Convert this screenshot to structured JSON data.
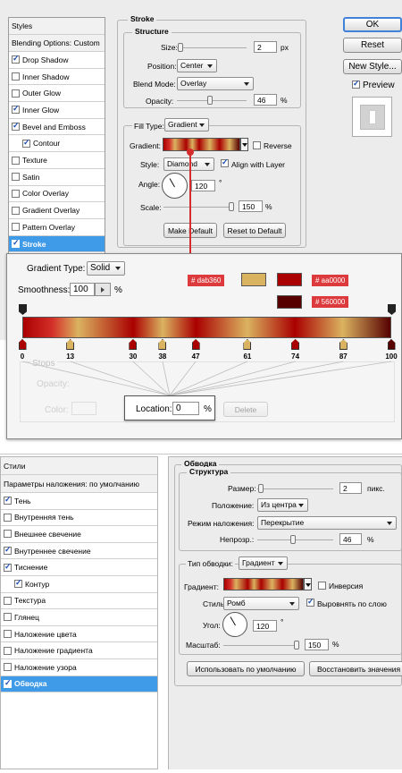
{
  "top": {
    "styles_header": "Styles",
    "items": [
      {
        "label": "Blending Options: Custom",
        "check": null
      },
      {
        "label": "Drop Shadow",
        "check": true
      },
      {
        "label": "Inner Shadow",
        "check": false
      },
      {
        "label": "Outer Glow",
        "check": false
      },
      {
        "label": "Inner Glow",
        "check": true
      },
      {
        "label": "Bevel and Emboss",
        "check": true
      },
      {
        "label": "Contour",
        "check": true
      },
      {
        "label": "Texture",
        "check": false
      },
      {
        "label": "Satin",
        "check": false
      },
      {
        "label": "Color Overlay",
        "check": false
      },
      {
        "label": "Gradient Overlay",
        "check": false
      },
      {
        "label": "Pattern Overlay",
        "check": false
      },
      {
        "label": "Stroke",
        "check": true
      }
    ],
    "stroke_title": "Stroke",
    "structure_title": "Structure",
    "size_label": "Size:",
    "size_value": "2",
    "size_unit": "px",
    "position_label": "Position:",
    "position_value": "Center",
    "blend_label": "Blend Mode:",
    "blend_value": "Overlay",
    "opacity_label": "Opacity:",
    "opacity_value": "46",
    "opacity_unit": "%",
    "filltype_label": "Fill Type:",
    "filltype_value": "Gradient",
    "gradient_label": "Gradient:",
    "reverse_label": "Reverse",
    "style_label": "Style:",
    "style_value": "Diamond",
    "align_label": "Align with Layer",
    "angle_label": "Angle:",
    "angle_value": "120",
    "angle_unit": "°",
    "scale_label": "Scale:",
    "scale_value": "150",
    "scale_unit": "%",
    "make_default": "Make Default",
    "reset_default": "Reset to Default",
    "ok": "OK",
    "reset": "Reset",
    "new_style": "New Style...",
    "preview": "Preview"
  },
  "editor": {
    "gradient_type_label": "Gradient Type:",
    "gradient_type_value": "Solid",
    "smoothness_label": "Smoothness:",
    "smoothness_value": "100",
    "smoothness_unit": "%",
    "tag1": "# dab360",
    "tag2": "# aa0000",
    "tag3": "# 560000",
    "swatch1": "#dab360",
    "swatch2": "#aa0000",
    "swatch3": "#560000",
    "stops": [
      "0",
      "13",
      "30",
      "38",
      "47",
      "61",
      "74",
      "87",
      "100"
    ],
    "stop_positions": [
      0,
      13,
      30,
      38,
      47,
      61,
      74,
      87,
      100
    ],
    "stop_colors": [
      "#aa0000",
      "#dab360",
      "#aa0000",
      "#dab360",
      "#aa0000",
      "#dab360",
      "#aa0000",
      "#dab360",
      "#560000"
    ],
    "ghost_stops": "Stops",
    "ghost_opacity": "Opacity:",
    "ghost_color": "Color:",
    "ghost_delete": "Delete",
    "location_label": "Location:",
    "location_value": "0",
    "location_unit": "%"
  },
  "ru": {
    "styles_header": "Стили",
    "items": [
      {
        "label": "Параметры наложения: по умолчанию",
        "check": null
      },
      {
        "label": "Тень",
        "check": true
      },
      {
        "label": "Внутренняя тень",
        "check": false
      },
      {
        "label": "Внешнее свечение",
        "check": false
      },
      {
        "label": "Внутреннее свечение",
        "check": true
      },
      {
        "label": "Тиснение",
        "check": true
      },
      {
        "label": "Контур",
        "check": true
      },
      {
        "label": "Текстура",
        "check": false
      },
      {
        "label": "Глянец",
        "check": false
      },
      {
        "label": "Наложение цвета",
        "check": false
      },
      {
        "label": "Наложение градиента",
        "check": false
      },
      {
        "label": "Наложение узора",
        "check": false
      },
      {
        "label": "Обводка",
        "check": true
      }
    ],
    "stroke_title": "Обводка",
    "structure_title": "Структура",
    "size_label": "Размер:",
    "size_value": "2",
    "size_unit": "пикс.",
    "position_label": "Положение:",
    "position_value": "Из центра",
    "blend_label": "Режим наложения:",
    "blend_value": "Перекрытие",
    "opacity_label": "Непрозр.:",
    "opacity_value": "46",
    "opacity_unit": "%",
    "filltype_label": "Тип обводки:",
    "filltype_value": "Градиент",
    "gradient_label": "Градиент:",
    "reverse_label": "Инверсия",
    "style_label": "Стиль:",
    "style_value": "Ромб",
    "align_label": "Выровнять по слою",
    "angle_label": "Угол:",
    "angle_value": "120",
    "angle_unit": "°",
    "scale_label": "Масштаб:",
    "scale_value": "150",
    "scale_unit": "%",
    "make_default": "Использовать по умолчанию",
    "reset_default": "Восстановить значения по"
  }
}
